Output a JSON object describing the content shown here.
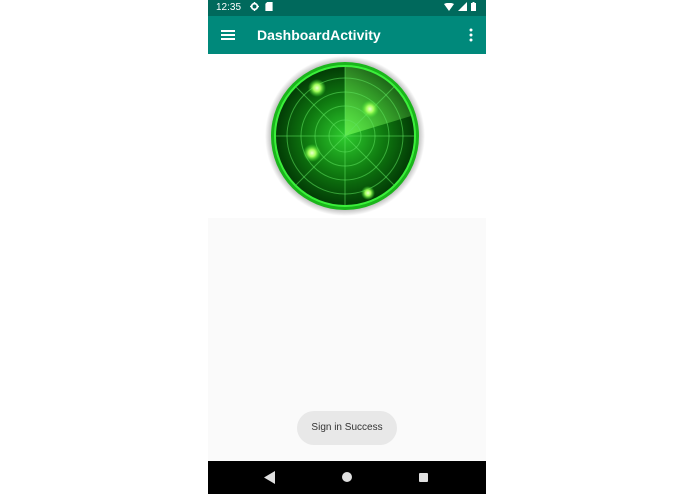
{
  "status_bar": {
    "time": "12:35"
  },
  "app_bar": {
    "title": "DashboardActivity"
  },
  "toast": {
    "message": "Sign in Success"
  },
  "icons": {
    "menu": "menu-icon",
    "overflow": "more-vert-icon",
    "settings": "gear-icon",
    "sd_card": "sd-card-icon",
    "wifi": "wifi-icon",
    "signal": "signal-icon",
    "battery": "battery-icon",
    "back": "back-icon",
    "home": "home-icon",
    "recent": "recent-apps-icon"
  },
  "colors": {
    "status_bar": "#00695c",
    "app_bar": "#00897b",
    "radar": "#1fd11f"
  }
}
